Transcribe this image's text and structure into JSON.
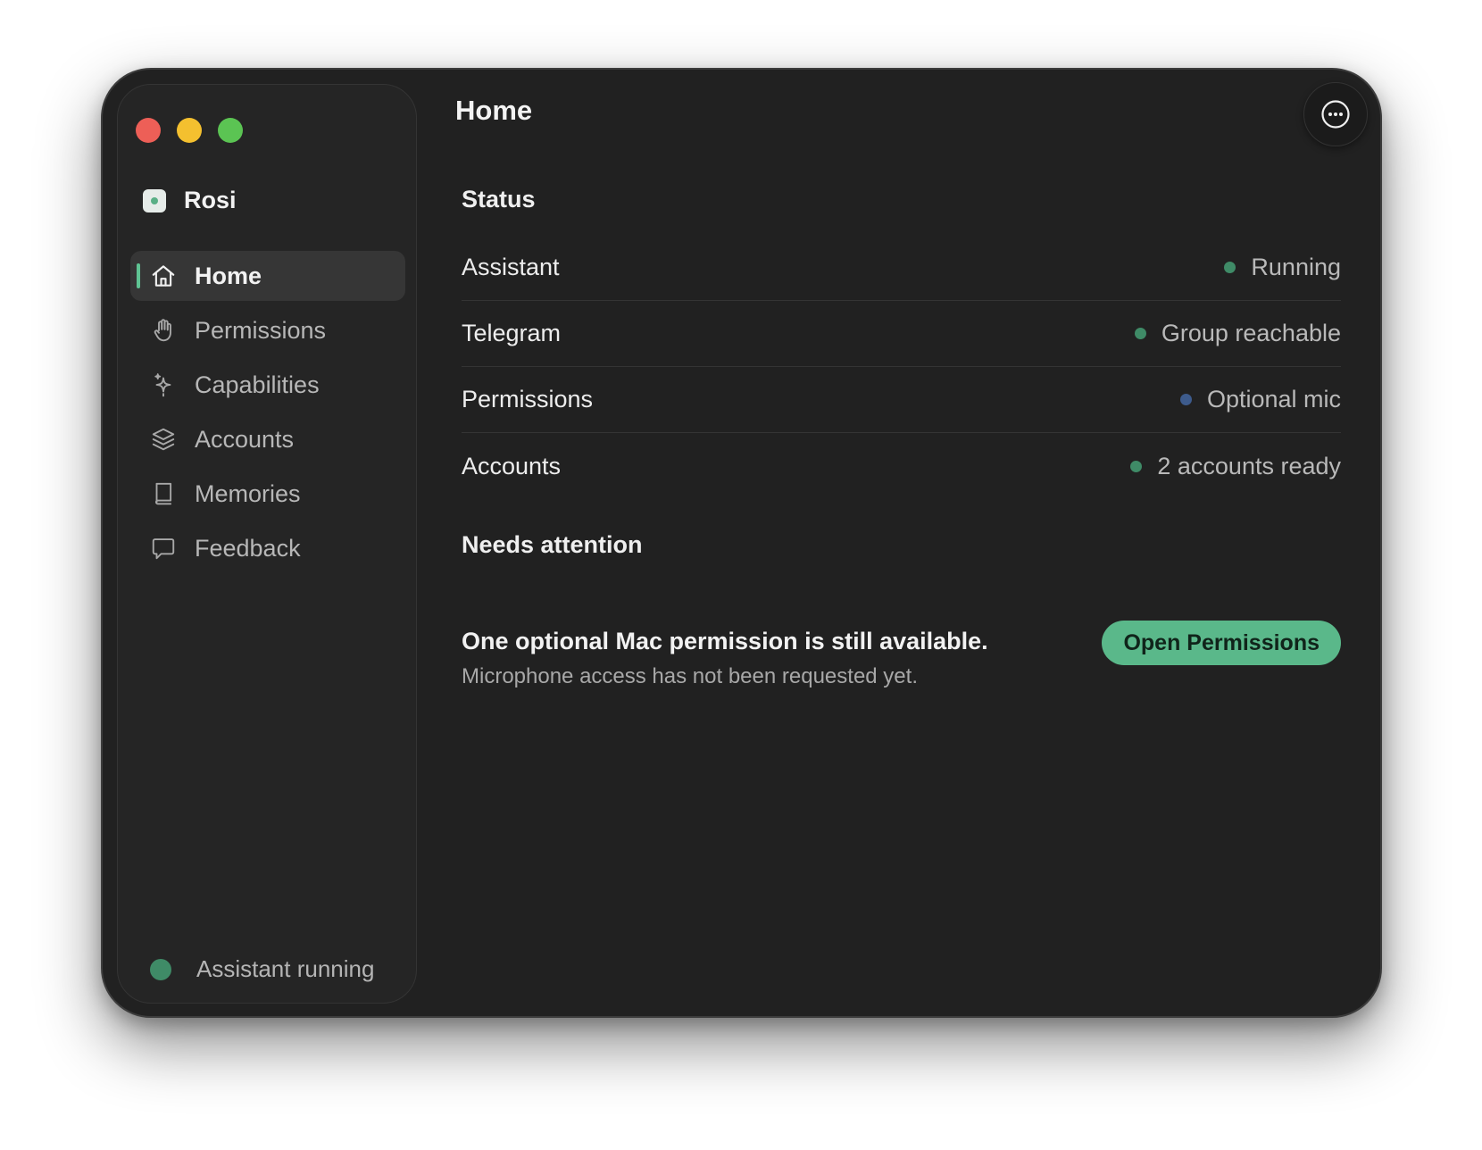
{
  "window": {
    "title": "Home"
  },
  "sidebar": {
    "app_name": "Rosi",
    "items": [
      {
        "label": "Home",
        "icon": "house-icon",
        "active": true
      },
      {
        "label": "Permissions",
        "icon": "hand-icon",
        "active": false
      },
      {
        "label": "Capabilities",
        "icon": "sparkle-icon",
        "active": false
      },
      {
        "label": "Accounts",
        "icon": "layers-icon",
        "active": false
      },
      {
        "label": "Memories",
        "icon": "book-icon",
        "active": false
      },
      {
        "label": "Feedback",
        "icon": "chat-bubble-icon",
        "active": false
      }
    ],
    "footer_status": "Assistant running"
  },
  "header": {
    "more_icon": "ellipsis-circle-icon"
  },
  "status": {
    "heading": "Status",
    "rows": [
      {
        "name": "Assistant",
        "value": "Running",
        "color": "#3f8b67"
      },
      {
        "name": "Telegram",
        "value": "Group reachable",
        "color": "#3f8b67"
      },
      {
        "name": "Permissions",
        "value": "Optional mic",
        "color": "#3d5b8c"
      },
      {
        "name": "Accounts",
        "value": "2 accounts ready",
        "color": "#3f8b67"
      }
    ]
  },
  "attention": {
    "heading": "Needs attention",
    "headline": "One optional Mac permission is still available.",
    "detail": "Microphone access has not been requested yet.",
    "button_label": "Open Permissions"
  },
  "colors": {
    "accent": "#5ab88a",
    "window_bg": "#212121",
    "sidebar_bg": "#252525"
  }
}
